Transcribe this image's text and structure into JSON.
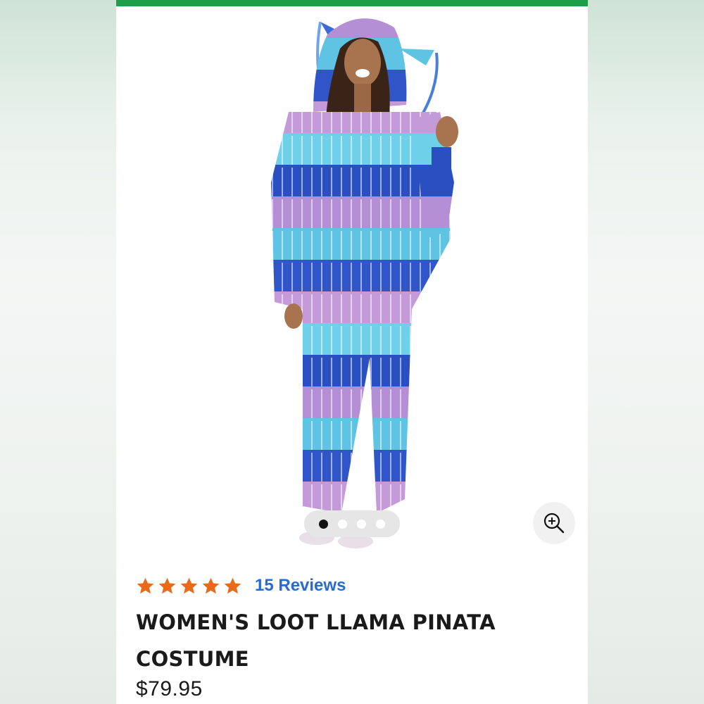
{
  "product": {
    "title": "WOMEN'S LOOT LLAMA PINATA COSTUME",
    "price": "$79.95",
    "rating": 5,
    "max_rating": 5,
    "reviews_label": "15 Reviews"
  },
  "carousel": {
    "total_images": 4,
    "active_index": 0
  },
  "icons": {
    "star": "star-icon",
    "zoom": "zoom-in-icon"
  },
  "colors": {
    "accent_bar": "#1f9e4a",
    "star": "#e86b1a",
    "link": "#2a6bd1",
    "text": "#1a1a1a"
  }
}
